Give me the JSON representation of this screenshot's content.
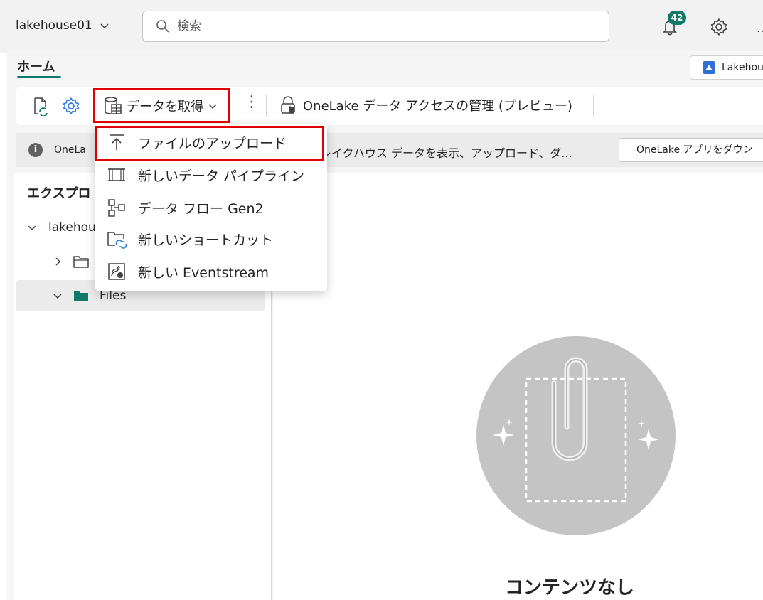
{
  "header": {
    "workspace_name": "lakehouse01",
    "search_placeholder": "検索",
    "notification_count": "42"
  },
  "tabs": {
    "home_label": "ホーム"
  },
  "lakehouse_button": {
    "label": "Lakehou"
  },
  "toolbar": {
    "get_data_label": "データを取得",
    "onelake_access_label": "OneLake データ アクセスの管理 (プレビュー)"
  },
  "info_bar": {
    "text_a": "OneLa",
    "text_b": "レイクハウス データを表示、アップロード、ダ...",
    "app_button_label": "OneLake アプリをダウン"
  },
  "explorer": {
    "title": "エクスプロ",
    "root_label": "lakehou",
    "files_label": "Files"
  },
  "menu": {
    "items": [
      {
        "label": "ファイルのアップロード",
        "icon": "upload-icon"
      },
      {
        "label": "新しいデータ パイプライン",
        "icon": "pipeline-icon"
      },
      {
        "label": "データ フロー Gen2",
        "icon": "dataflow-icon"
      },
      {
        "label": "新しいショートカット",
        "icon": "shortcut-icon"
      },
      {
        "label": "新しい Eventstream",
        "icon": "eventstream-icon"
      }
    ]
  },
  "main": {
    "empty_text": "コンテンツなし"
  },
  "colors": {
    "accent": "#117865",
    "highlight": "#e20000"
  }
}
